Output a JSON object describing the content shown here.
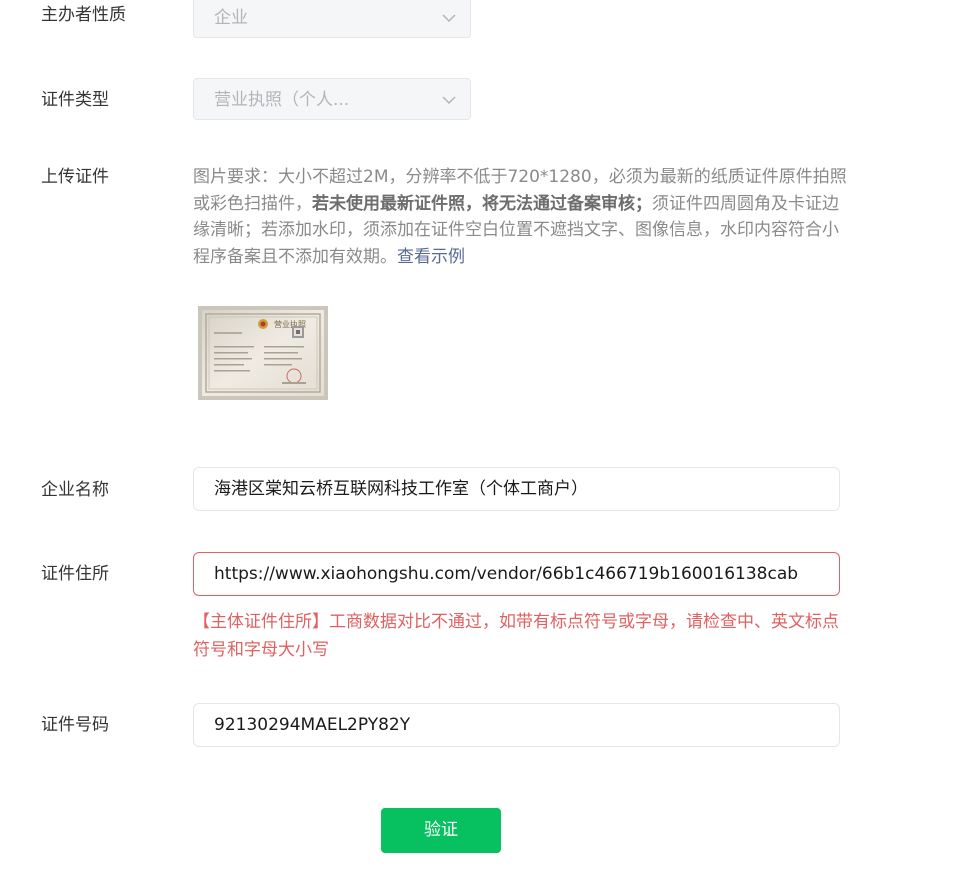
{
  "form": {
    "organizer_type": {
      "label": "主办者性质",
      "value": "企业"
    },
    "cert_type": {
      "label": "证件类型",
      "value": "营业执照（个人..."
    },
    "upload": {
      "label": "上传证件",
      "desc_part1": "图片要求：大小不超过2M，分辨率不低于720*1280，必须为最新的纸质证件原件拍照或彩色扫描件，",
      "desc_strong": "若未使用最新证件照，将无法通过备案审核；",
      "desc_part2": "须证件四周圆角及卡证边缘清晰；若添加水印，须添加在证件空白位置不遮挡文字、图像信息，水印内容符合小程序备案且不添加有效期。",
      "example_link": "查看示例",
      "thumbnail_title": "营业执照"
    },
    "company_name": {
      "label": "企业名称",
      "value": "海港区棠知云桥互联网科技工作室（个体工商户）"
    },
    "cert_address": {
      "label": "证件住所",
      "value": "https://www.xiaohongshu.com/vendor/66b1c466719b160016138cab",
      "error": "【主体证件住所】工商数据对比不通过，如带有标点符号或字母，请检查中、英文标点符号和字母大小写"
    },
    "cert_number": {
      "label": "证件号码",
      "value": "92130294MAEL2PY82Y"
    },
    "verify_button": "验证"
  },
  "colors": {
    "primary_green": "#07c160",
    "error_red": "#e06161",
    "link_blue": "#576b95"
  }
}
